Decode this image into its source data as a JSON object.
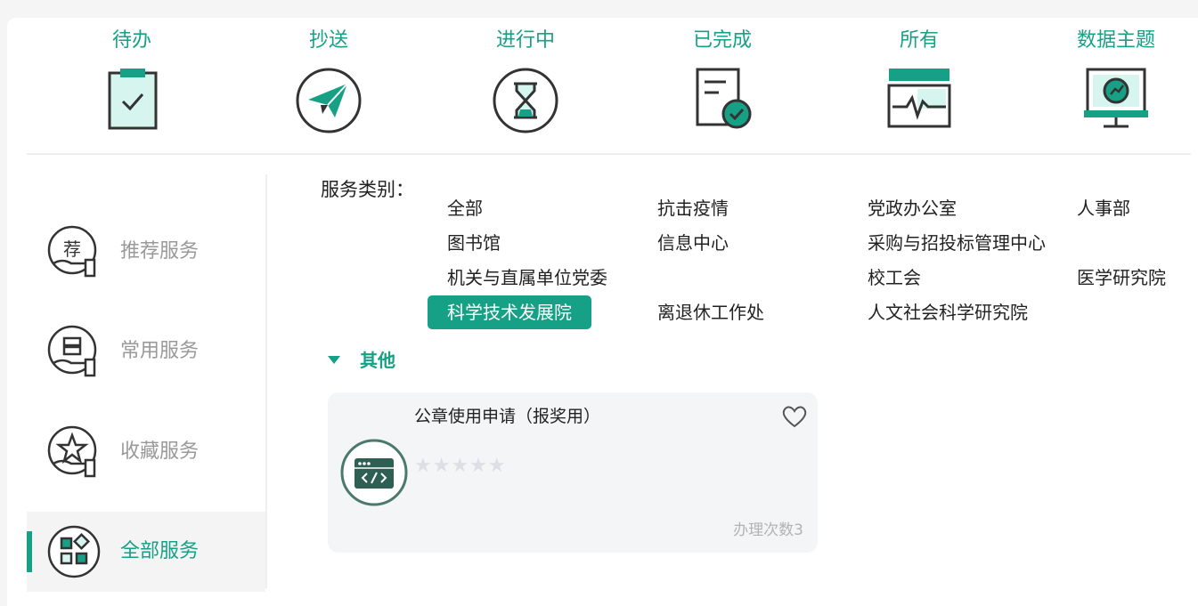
{
  "top_tabs": [
    {
      "label": "待办",
      "icon": "clipboard-check-icon"
    },
    {
      "label": "抄送",
      "icon": "paper-plane-icon"
    },
    {
      "label": "进行中",
      "icon": "hourglass-icon"
    },
    {
      "label": "已完成",
      "icon": "document-done-icon"
    },
    {
      "label": "所有",
      "icon": "monitor-pulse-icon"
    },
    {
      "label": "数据主题",
      "icon": "data-screen-icon"
    }
  ],
  "sidebar": {
    "items": [
      {
        "label": "推荐服务",
        "icon_char": "荐",
        "icon": "recommend-hand-icon"
      },
      {
        "label": "常用服务",
        "icon": "common-hand-icon"
      },
      {
        "label": "收藏服务",
        "icon": "favorite-hand-icon"
      },
      {
        "label": "全部服务",
        "icon": "grid-apps-icon",
        "active": true
      }
    ]
  },
  "categories": {
    "title": "服务类别：",
    "items": [
      "全部",
      "抗击疫情",
      "党政办公室",
      "人事部",
      "图书馆",
      "信息中心",
      "采购与招投标管理中心",
      "机关与直属单位党委",
      "校工会",
      "医学研究院",
      "科学技术发展院",
      "离退休工作处",
      "人文社会科学研究院"
    ],
    "active": "科学技术发展院"
  },
  "group": {
    "title": "其他"
  },
  "card": {
    "title": "公章使用申请（报奖用）",
    "stars": "★★★★★",
    "rating": 0,
    "count_label": "办理次数",
    "count_value": "3",
    "icon": "code-window-icon",
    "fav_icon": "heart-outline-icon"
  },
  "colors": {
    "accent": "#16a085",
    "accent_light": "#d6f5ee",
    "icon_stroke": "#333333",
    "muted": "#999999"
  }
}
